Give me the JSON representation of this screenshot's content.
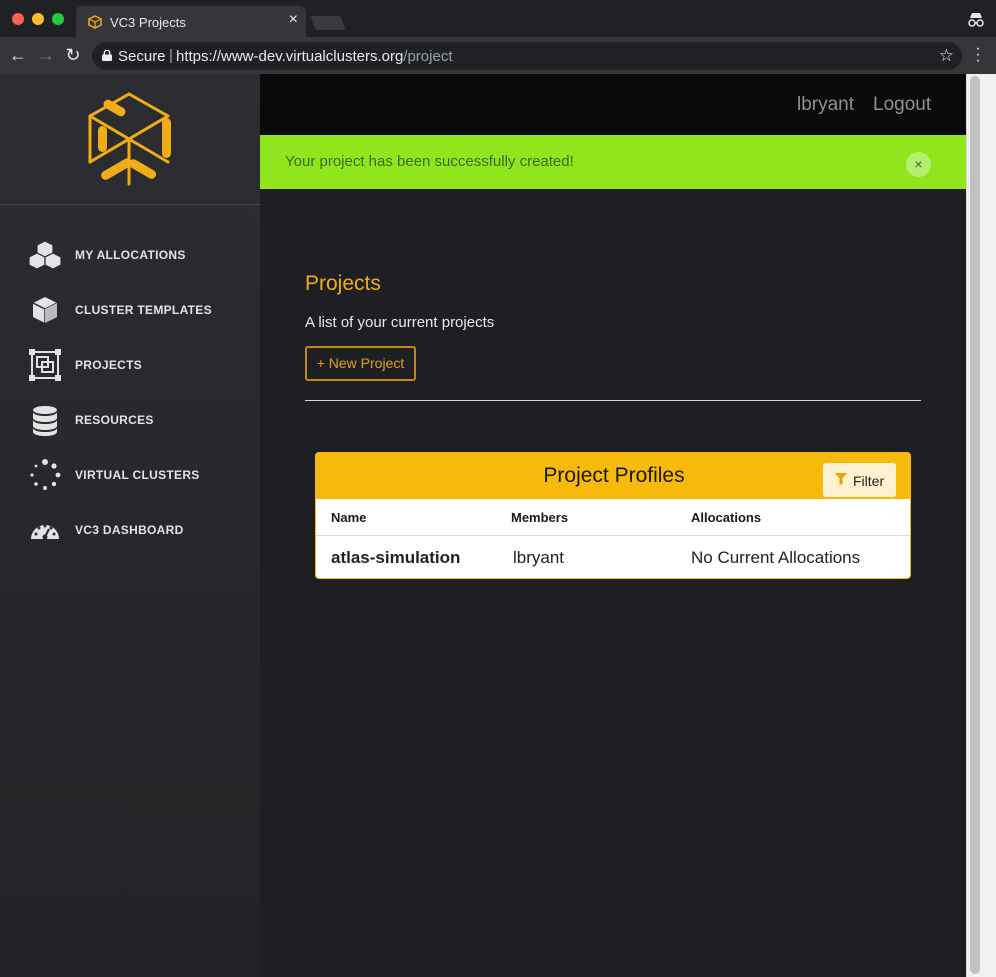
{
  "browser": {
    "tab_title": "VC3 Projects",
    "tab_close": "×",
    "secure_label": "Secure",
    "url_host": "https://www-dev.virtualclusters.org",
    "url_path": "/project"
  },
  "sidebar": {
    "items": [
      {
        "label": "MY ALLOCATIONS",
        "icon": "cubes-icon"
      },
      {
        "label": "CLUSTER TEMPLATES",
        "icon": "cube-icon"
      },
      {
        "label": "PROJECTS",
        "icon": "object-group-icon"
      },
      {
        "label": "RESOURCES",
        "icon": "database-icon"
      },
      {
        "label": "VIRTUAL CLUSTERS",
        "icon": "spinner-icon"
      },
      {
        "label": "VC3 DASHBOARD",
        "icon": "dashboard-icon"
      }
    ]
  },
  "header": {
    "username": "lbryant",
    "logout": "Logout"
  },
  "alert": {
    "message": "Your project has been successfully created!",
    "close": "×"
  },
  "main": {
    "title": "Projects",
    "subtitle": "A list of your current projects",
    "new_button": "+ New Project"
  },
  "table": {
    "title": "Project Profiles",
    "filter_label": "Filter",
    "columns": [
      "Name",
      "Members",
      "Allocations"
    ],
    "rows": [
      {
        "name": "atlas-simulation",
        "members": "lbryant",
        "allocations": "No Current Allocations"
      }
    ]
  },
  "colors": {
    "accent": "#f0ad17",
    "alert_bg": "#8fe61d",
    "card_header": "#f7b90a"
  }
}
